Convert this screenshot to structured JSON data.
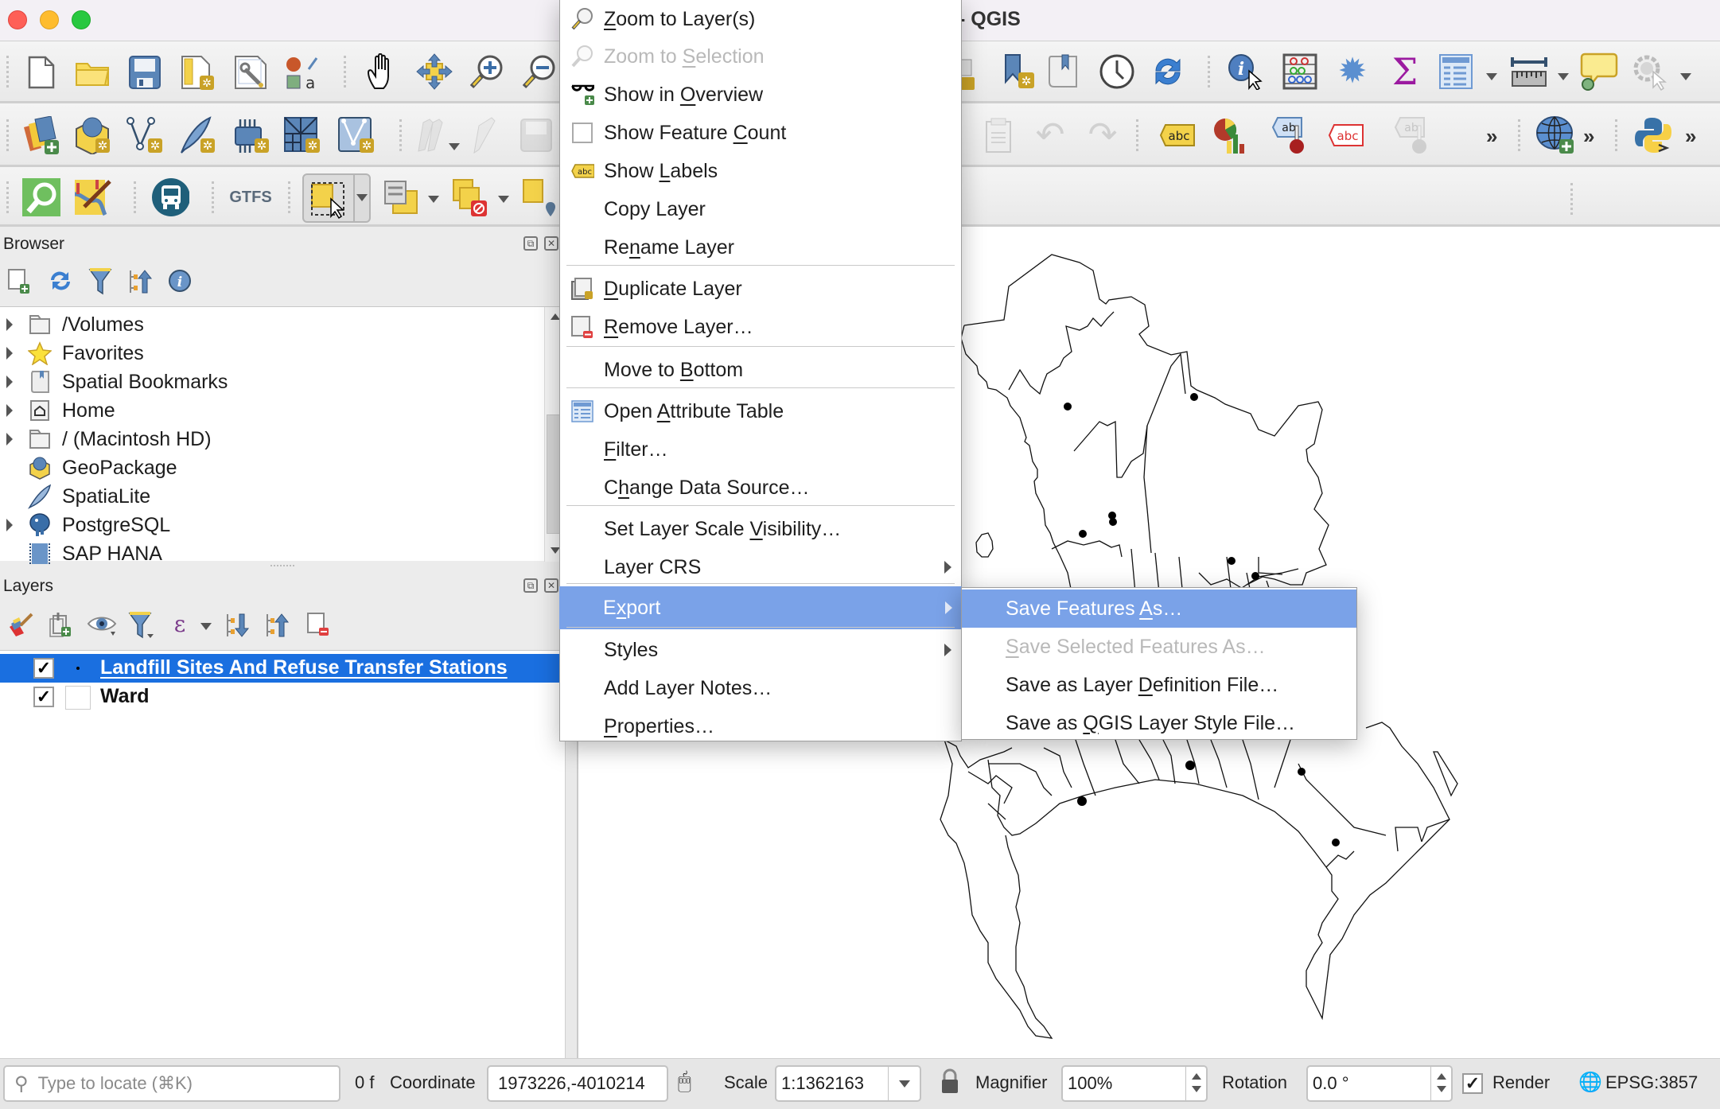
{
  "window": {
    "title": "- QGIS",
    "traffic_lights": {
      "close": "#fe5f57",
      "minimize": "#febc2e",
      "zoom": "#28c840"
    }
  },
  "toolbars": {
    "row1_icons": [
      "new-project-icon",
      "open-project-icon",
      "save-project-icon",
      "new-print-layout-icon",
      "layout-manager-icon",
      "style-manager-icon",
      "pan-icon",
      "pan-to-selection-icon",
      "zoom-in-icon",
      "zoom-out-icon",
      "new-bookmark-icon",
      "show-bookmarks-icon",
      "temporal-controller-icon",
      "refresh-icon",
      "identify-icon",
      "attribute-calculator-icon",
      "toolbox-gear-icon",
      "statistical-summary-icon",
      "open-attribute-table-icon",
      "measure-icon",
      "map-tips-icon",
      "run-action-icon"
    ],
    "row2_icons": [
      "data-source-manager-icon",
      "new-geopackage-layer-icon",
      "new-shapefile-layer-icon",
      "new-spatialite-layer-icon",
      "new-virtual-layer-icon",
      "new-mesh-layer-icon",
      "new-temporary-scratch-layer-icon",
      "current-edits-icon",
      "toggle-editing-icon",
      "save-edits-icon",
      "paste-features-icon",
      "undo-icon",
      "redo-icon",
      "label-tool-icon",
      "diagram-tool-icon",
      "pin-labels-icon",
      "highlight-pinned-labels-icon",
      "rotate-label-icon",
      "add-wms-layer-icon",
      "python-console-icon"
    ],
    "row3_icons": [
      "locator-search-icon",
      "georeferencer-icon",
      "gtfs-transit-icon",
      "gtfs-icon",
      "select-features-icon",
      "select-by-attribute-icon",
      "deselect-features-icon",
      "select-by-location-icon"
    ],
    "overflow_label": "»",
    "gtfs_label": "GTFS"
  },
  "browser": {
    "title": "Browser",
    "toolbar_icons": [
      "add-selected-layers-icon",
      "refresh-icon",
      "filter-icon",
      "collapse-all-icon",
      "properties-info-icon"
    ],
    "items": [
      {
        "label": "/Volumes",
        "icon": "folder-icon",
        "expandable": true
      },
      {
        "label": "Favorites",
        "icon": "star-icon",
        "expandable": true
      },
      {
        "label": "Spatial Bookmarks",
        "icon": "bookmark-icon",
        "expandable": true
      },
      {
        "label": "Home",
        "icon": "home-folder-icon",
        "expandable": true
      },
      {
        "label": "/ (Macintosh HD)",
        "icon": "folder-icon",
        "expandable": true
      },
      {
        "label": "GeoPackage",
        "icon": "geopackage-icon",
        "expandable": false
      },
      {
        "label": "SpatiaLite",
        "icon": "feather-icon",
        "expandable": false
      },
      {
        "label": "PostgreSQL",
        "icon": "elephant-icon",
        "expandable": true
      },
      {
        "label": "SAP HANA",
        "icon": "sap-hana-icon",
        "expandable": false
      }
    ]
  },
  "layers": {
    "title": "Layers",
    "toolbar_icons": [
      "style-panel-icon",
      "add-group-icon",
      "manage-visibility-icon",
      "filter-legend-icon",
      "filter-by-expression-icon",
      "expand-all-icon",
      "collapse-all-icon",
      "remove-layer-icon"
    ],
    "items": [
      {
        "label": "Landfill Sites And Refuse Transfer Stations",
        "checked": true,
        "selected": true,
        "symbol": "point"
      },
      {
        "label": "Ward",
        "checked": true,
        "selected": false,
        "symbol": "polygon"
      }
    ]
  },
  "context_menu": {
    "items": [
      {
        "label": "Zoom to Layer(s)",
        "icon": "zoom-to-layer-icon",
        "underline": "Z",
        "disabled": false
      },
      {
        "label": "Zoom to Selection",
        "icon": "zoom-to-selection-icon",
        "underline": "S",
        "disabled": true
      },
      {
        "label": "Show in Overview",
        "icon": "glasses-icon",
        "underline": "O",
        "disabled": false
      },
      {
        "label": "Show Feature Count",
        "icon": "checkbox-icon",
        "underline": "C",
        "disabled": false,
        "checked": false
      },
      {
        "label": "Show Labels",
        "icon": "labels-abc-icon",
        "underline": "L",
        "disabled": false
      },
      {
        "label": "Copy Layer",
        "icon": "",
        "disabled": false
      },
      {
        "label": "Rename Layer",
        "icon": "",
        "underline": "n",
        "disabled": false
      },
      {
        "label": "Duplicate Layer",
        "icon": "duplicate-layer-icon",
        "underline": "D",
        "disabled": false
      },
      {
        "label": "Remove Layer…",
        "icon": "remove-layer-icon",
        "underline": "R",
        "disabled": false
      },
      {
        "label": "Move to Bottom",
        "icon": "",
        "underline": "B",
        "disabled": false
      },
      {
        "label": "Open Attribute Table",
        "icon": "attribute-table-icon",
        "underline": "A",
        "disabled": false
      },
      {
        "label": "Filter…",
        "icon": "",
        "underline": "F",
        "disabled": false
      },
      {
        "label": "Change Data Source…",
        "icon": "",
        "underline": "h",
        "disabled": false
      },
      {
        "label": "Set Layer Scale Visibility…",
        "icon": "",
        "underline": "V",
        "disabled": false
      },
      {
        "label": "Layer CRS",
        "icon": "",
        "submenu": true,
        "disabled": false
      },
      {
        "label": "Export",
        "icon": "",
        "submenu": true,
        "active": true,
        "underline": "x",
        "disabled": false
      },
      {
        "label": "Styles",
        "icon": "",
        "submenu": true,
        "disabled": false
      },
      {
        "label": "Add Layer Notes…",
        "icon": "",
        "disabled": false
      },
      {
        "label": "Properties…",
        "icon": "",
        "underline": "P",
        "disabled": false
      }
    ]
  },
  "export_submenu": {
    "items": [
      {
        "label": "Save Features As…",
        "active": true,
        "disabled": false
      },
      {
        "label": "Save Selected Features As…",
        "active": false,
        "disabled": true
      },
      {
        "label": "Save as Layer Definition File…",
        "active": false,
        "disabled": false
      },
      {
        "label": "Save as QGIS Layer Style File…",
        "active": false,
        "disabled": false
      }
    ]
  },
  "statusbar": {
    "locator_placeholder": "Type to locate (⌘K)",
    "message": "0 f",
    "coordinate_label": "Coordinate",
    "coordinate_value": "1973226,-4010214",
    "scale_label": "Scale",
    "scale_value": "1:1362163",
    "magnifier_label": "Magnifier",
    "magnifier_value": "100%",
    "rotation_label": "Rotation",
    "rotation_value": "0.0 °",
    "render_label": "Render",
    "render_checked": true,
    "crs_label": "EPSG:3857"
  },
  "colors": {
    "menu_highlight": "#7aa2e8",
    "layer_selected": "#1a6fe0",
    "disabled_text": "#b9b9b9"
  }
}
